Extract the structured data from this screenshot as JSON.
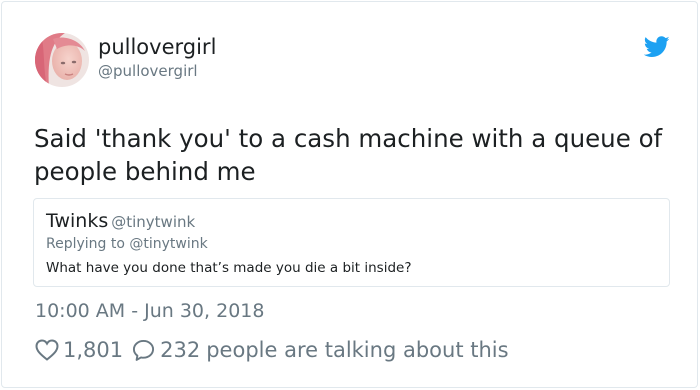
{
  "user": {
    "display_name": "pullovergirl",
    "handle": "@pullovergirl"
  },
  "tweet": {
    "text": "Said 'thank you' to a cash machine with a queue of people behind me",
    "timestamp": "10:00 AM - Jun 30, 2018"
  },
  "quoted": {
    "display_name": "Twinks",
    "handle": "@tinytwink",
    "replying_to": "Replying to @tinytwink",
    "text": "What have you done that’s made you die a bit inside?"
  },
  "actions": {
    "likes": "1,801",
    "replies": "232",
    "talking_label": "people are talking about this"
  },
  "icons": {
    "brand": "twitter-bird-icon",
    "like": "heart-icon",
    "reply": "speech-bubble-icon"
  },
  "colors": {
    "twitter_blue": "#1da1f2",
    "secondary_text": "#697882",
    "primary_text": "#1c2022",
    "border": "#e1e8ed"
  }
}
